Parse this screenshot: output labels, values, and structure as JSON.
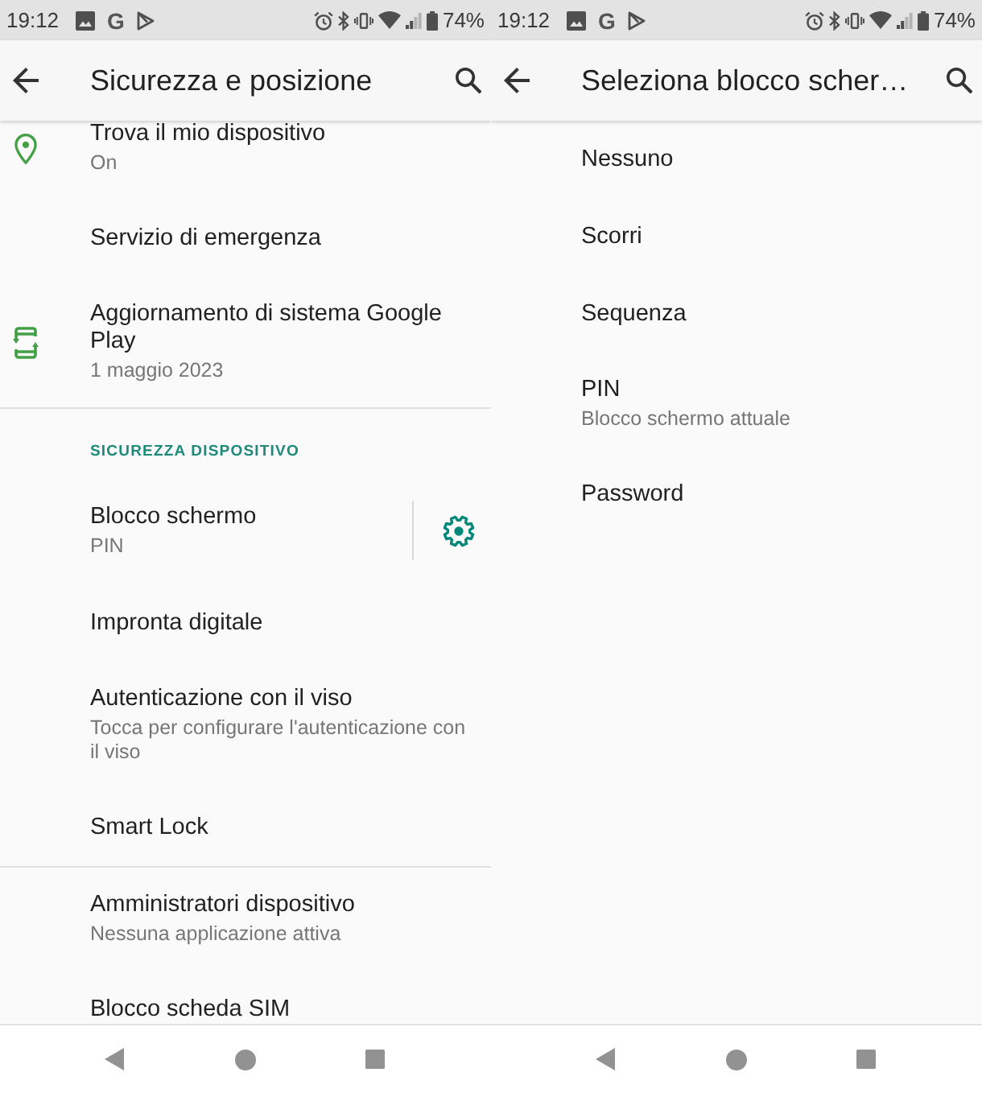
{
  "screens": [
    {
      "status_bar": {
        "time": "19:12",
        "notification_letter": "G",
        "battery": "74%"
      },
      "app_bar": {
        "title": "Sicurezza e posizione"
      },
      "scrolled": true,
      "groups": [
        {
          "items": [
            {
              "kind": "location",
              "title": "Trova il mio dispositivo",
              "subtitle": "On"
            },
            {
              "kind": "plain",
              "title": "Servizio di emergenza"
            },
            {
              "kind": "update",
              "title": "Aggiornamento di sistema Google Play",
              "subtitle": "1 maggio 2023"
            }
          ]
        },
        {
          "header": "SICUREZZA DISPOSITIVO",
          "items": [
            {
              "kind": "settings",
              "title": "Blocco schermo",
              "subtitle": "PIN"
            },
            {
              "kind": "plain",
              "title": "Impronta digitale"
            },
            {
              "kind": "plain",
              "title": "Autenticazione con il viso",
              "subtitle": "Tocca per configurare l'autenticazione con il viso"
            },
            {
              "kind": "plain",
              "title": "Smart Lock"
            }
          ]
        },
        {
          "items": [
            {
              "kind": "plain",
              "title": "Amministratori dispositivo",
              "subtitle": "Nessuna applicazione attiva"
            },
            {
              "kind": "plain",
              "title": "Blocco scheda SIM"
            }
          ]
        }
      ]
    },
    {
      "status_bar": {
        "time": "19:12",
        "notification_letter": "G",
        "battery": "74%"
      },
      "app_bar": {
        "title": "Seleziona blocco scher…"
      },
      "scrolled": false,
      "groups": [
        {
          "items": [
            {
              "kind": "plain",
              "title": "Nessuno"
            },
            {
              "kind": "plain",
              "title": "Scorri"
            },
            {
              "kind": "plain",
              "title": "Sequenza"
            },
            {
              "kind": "plain",
              "title": "PIN",
              "subtitle": "Blocco schermo attuale"
            },
            {
              "kind": "plain",
              "title": "Password"
            }
          ]
        }
      ]
    }
  ]
}
